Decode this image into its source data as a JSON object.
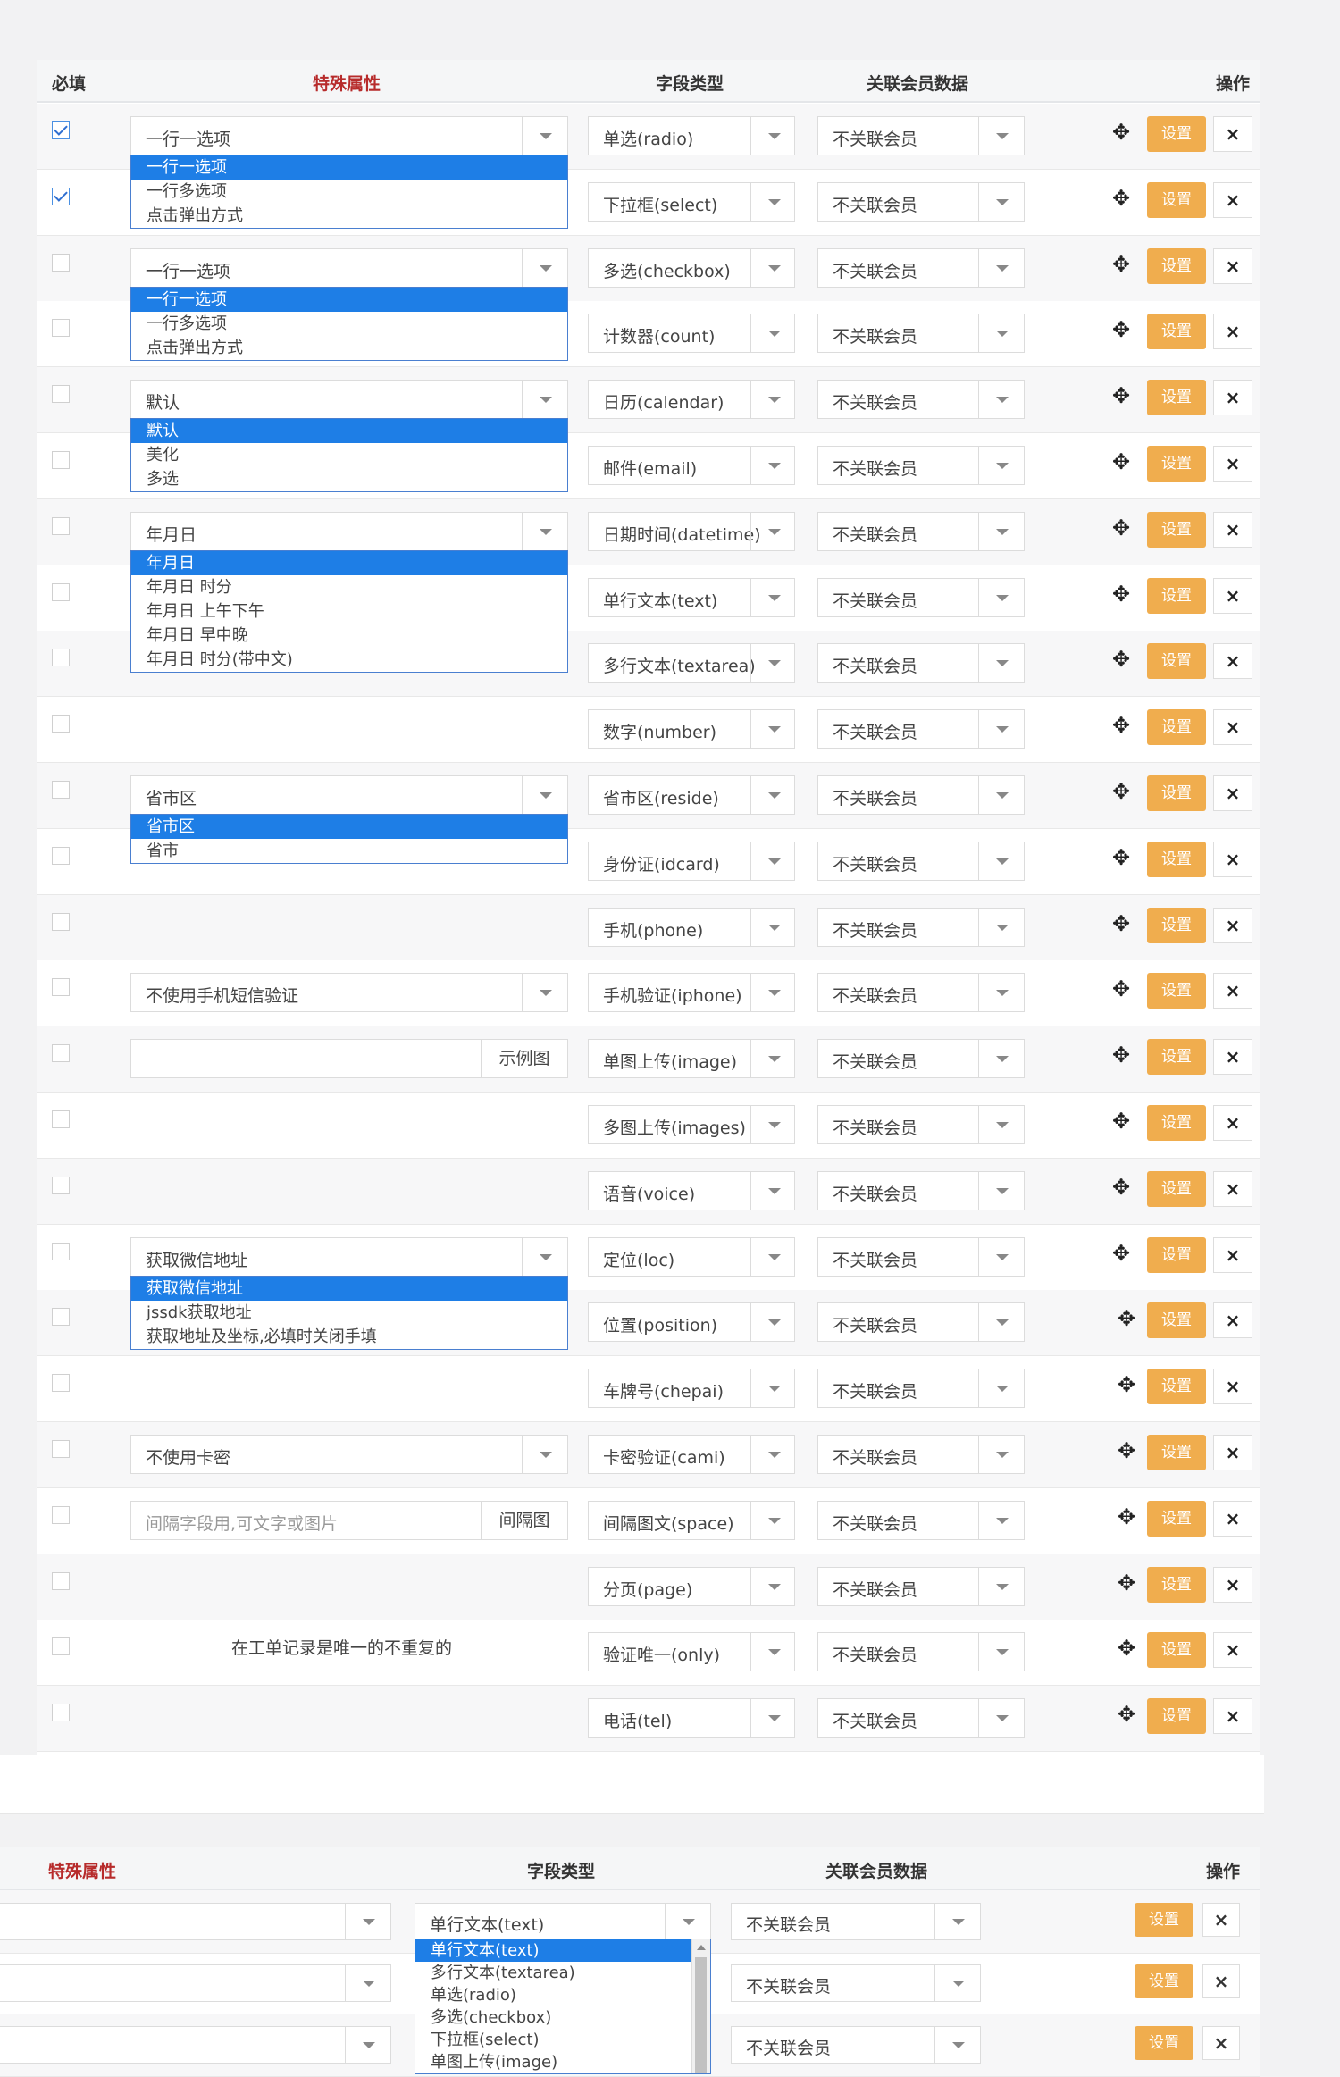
{
  "header": {
    "required": "必填",
    "special": "特殊属性",
    "type": "字段类型",
    "member": "关联会员数据",
    "ops": "操作"
  },
  "set_label": "设置",
  "del_label": "×",
  "move_icon": "✥",
  "rows": [
    {
      "checked": true,
      "attr_select": "一行一选项",
      "type": "单选(radio)",
      "member": "不关联会员"
    },
    {
      "checked": true,
      "type": "下拉框(select)",
      "member": "不关联会员"
    },
    {
      "checked": false,
      "attr_select": "一行一选项",
      "type": "多选(checkbox)",
      "member": "不关联会员"
    },
    {
      "checked": false,
      "type": "计数器(count)",
      "member": "不关联会员"
    },
    {
      "checked": false,
      "attr_select": "默认",
      "type": "日历(calendar)",
      "member": "不关联会员"
    },
    {
      "checked": false,
      "type": "邮件(email)",
      "member": "不关联会员"
    },
    {
      "checked": false,
      "attr_select": "年月日",
      "type": "日期时间(datetime)",
      "member": "不关联会员"
    },
    {
      "checked": false,
      "type": "单行文本(text)",
      "member": "不关联会员"
    },
    {
      "checked": false,
      "type": "多行文本(textarea)",
      "member": "不关联会员"
    },
    {
      "checked": false,
      "type": "数字(number)",
      "member": "不关联会员"
    },
    {
      "checked": false,
      "attr_select": "省市区",
      "type": "省市区(reside)",
      "member": "不关联会员"
    },
    {
      "checked": false,
      "type": "身份证(idcard)",
      "member": "不关联会员"
    },
    {
      "checked": false,
      "type": "手机(phone)",
      "member": "不关联会员"
    },
    {
      "checked": false,
      "attr_select": "不使用手机短信验证",
      "type": "手机验证(iphone)",
      "member": "不关联会员"
    },
    {
      "checked": false,
      "attr_input": {
        "placeholder": "",
        "addon": "示例图"
      },
      "type": "单图上传(image)",
      "member": "不关联会员"
    },
    {
      "checked": false,
      "type": "多图上传(images)",
      "member": "不关联会员"
    },
    {
      "checked": false,
      "type": "语音(voice)",
      "member": "不关联会员"
    },
    {
      "checked": false,
      "attr_select": "获取微信地址",
      "type": "定位(loc)",
      "member": "不关联会员"
    },
    {
      "checked": false,
      "type": "位置(position)",
      "member": "不关联会员"
    },
    {
      "checked": false,
      "type": "车牌号(chepai)",
      "member": "不关联会员"
    },
    {
      "checked": false,
      "attr_select": "不使用卡密",
      "type": "卡密验证(cami)",
      "member": "不关联会员"
    },
    {
      "checked": false,
      "attr_input": {
        "placeholder": "间隔字段用,可文字或图片",
        "addon": "间隔图"
      },
      "type": "间隔图文(space)",
      "member": "不关联会员"
    },
    {
      "checked": false,
      "type": "分页(page)",
      "member": "不关联会员"
    },
    {
      "checked": false,
      "attr_note": "在工单记录是唯一的不重复的",
      "type": "验证唯一(only)",
      "member": "不关联会员"
    },
    {
      "checked": false,
      "type": "电话(tel)",
      "member": "不关联会员"
    }
  ],
  "dropdowns": [
    {
      "options": [
        "一行一选项",
        "一行多选项",
        "点击弹出方式"
      ],
      "selected": 0
    },
    {
      "options": [
        "一行一选项",
        "一行多选项",
        "点击弹出方式"
      ],
      "selected": 0
    },
    {
      "options": [
        "默认",
        "美化",
        "多选"
      ],
      "selected": 0
    },
    {
      "options": [
        "年月日",
        "年月日 时分",
        "年月日 上午下午",
        "年月日 早中晚",
        "年月日 时分(带中文)"
      ],
      "selected": 0
    },
    {
      "options": [
        "省市区",
        "省市"
      ],
      "selected": 0
    },
    {
      "options": [
        "获取微信地址",
        "jssdk获取地址",
        "获取地址及坐标,必填时关闭手填"
      ],
      "selected": 0
    }
  ],
  "section2": {
    "header": {
      "special": "特殊属性",
      "type": "字段类型",
      "member": "关联会员数据",
      "ops": "操作"
    },
    "rows": [
      {
        "type": "单行文本(text)",
        "member": "不关联会员"
      },
      {
        "type": "",
        "member": "不关联会员"
      },
      {
        "type": "",
        "member": "不关联会员"
      }
    ],
    "type_dropdown": [
      "单行文本(text)",
      "多行文本(textarea)",
      "单选(radio)",
      "多选(checkbox)",
      "下拉框(select)",
      "单图上传(image)"
    ]
  }
}
